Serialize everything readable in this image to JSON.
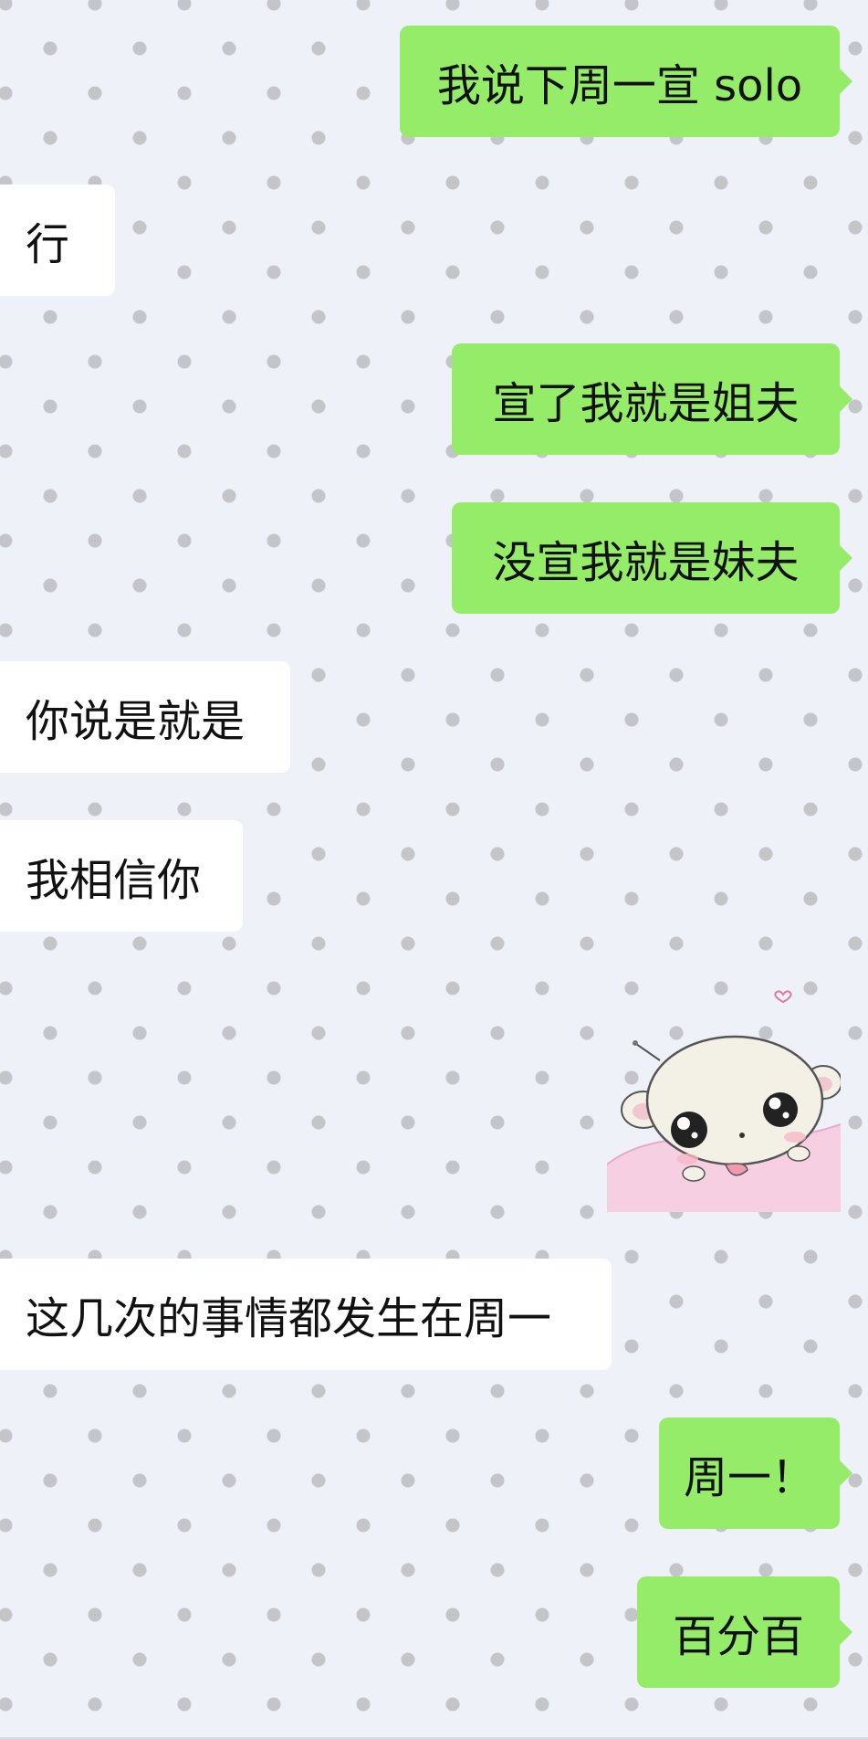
{
  "messages": [
    {
      "side": "sent",
      "text": "我说下周一宣 solo"
    },
    {
      "side": "received",
      "text": "行"
    },
    {
      "side": "sent",
      "text": "宣了我就是姐夫"
    },
    {
      "side": "sent",
      "text": "没宣我就是妹夫"
    },
    {
      "side": "received",
      "text": "你说是就是"
    },
    {
      "side": "received",
      "text": "我相信你"
    },
    {
      "side": "sent",
      "type": "sticker",
      "sticker": "hamster-sticker"
    },
    {
      "side": "received",
      "text": "这几次的事情都发生在周一"
    },
    {
      "side": "sent",
      "text": "周一！"
    },
    {
      "side": "sent",
      "text": "百分百"
    }
  ],
  "colors": {
    "sent_bubble": "#95ec69",
    "received_bubble": "#ffffff",
    "background": "#eef1f8",
    "background_dots": "#c3c5c9"
  }
}
